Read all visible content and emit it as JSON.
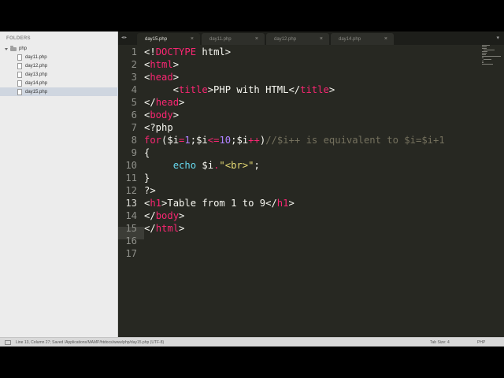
{
  "sidebar": {
    "header": "FOLDERS",
    "folder": "php",
    "files": [
      "day11.php",
      "day12.php",
      "day13.php",
      "day14.php",
      "day15.php"
    ],
    "active_file": "day15.php"
  },
  "tabs": [
    "day15.php",
    "day11.php",
    "day12.php",
    "day14.php"
  ],
  "active_tab": "day15.php",
  "editor": {
    "current_line": 13,
    "lines": [
      [
        [
          "<!",
          "t-txt"
        ],
        [
          "DOCTYPE",
          "t-tag"
        ],
        [
          " html>",
          "t-txt"
        ]
      ],
      [
        [
          "<",
          "t-txt"
        ],
        [
          "html",
          "t-tag"
        ],
        [
          ">",
          "t-txt"
        ]
      ],
      [
        [
          "<",
          "t-txt"
        ],
        [
          "head",
          "t-tag"
        ],
        [
          ">",
          "t-txt"
        ]
      ],
      [
        [
          "     <",
          "t-txt"
        ],
        [
          "title",
          "t-tag"
        ],
        [
          ">PHP with HTML</",
          "t-txt"
        ],
        [
          "title",
          "t-tag"
        ],
        [
          ">",
          "t-txt"
        ]
      ],
      [
        [
          "</",
          "t-txt"
        ],
        [
          "head",
          "t-tag"
        ],
        [
          ">",
          "t-txt"
        ]
      ],
      [
        [
          "<",
          "t-txt"
        ],
        [
          "body",
          "t-tag"
        ],
        [
          ">",
          "t-txt"
        ]
      ],
      [
        [
          "<?php",
          "t-txt"
        ]
      ],
      [
        [
          "for",
          "t-kw"
        ],
        [
          "(",
          "t-txt"
        ],
        [
          "$i",
          "t-txt"
        ],
        [
          "=",
          "t-op"
        ],
        [
          "1",
          "t-num"
        ],
        [
          ";",
          "t-txt"
        ],
        [
          "$i",
          "t-txt"
        ],
        [
          "<=",
          "t-op"
        ],
        [
          "10",
          "t-num"
        ],
        [
          ";",
          "t-txt"
        ],
        [
          "$i",
          "t-txt"
        ],
        [
          "++",
          "t-op"
        ],
        [
          ")",
          "t-txt"
        ],
        [
          "//$i++ is equivalent to $i=$i+1",
          "t-cm"
        ]
      ],
      [
        [
          "{",
          "t-txt"
        ]
      ],
      [
        [
          "     ",
          "t-txt"
        ],
        [
          "echo",
          "t-fn"
        ],
        [
          " $i",
          "t-txt"
        ],
        [
          ".",
          "t-op"
        ],
        [
          "\"<br>\"",
          "t-str"
        ],
        [
          ";",
          "t-txt"
        ]
      ],
      [
        [
          "}",
          "t-txt"
        ]
      ],
      [
        [
          "?>",
          "t-txt"
        ]
      ],
      [
        [
          "<",
          "t-txt"
        ],
        [
          "h1",
          "t-tag"
        ],
        [
          ">Table from 1 to 9</",
          "t-txt"
        ],
        [
          "h1",
          "t-tag"
        ],
        [
          ">",
          "t-txt"
        ]
      ],
      [
        [
          "</",
          "t-txt"
        ],
        [
          "body",
          "t-tag"
        ],
        [
          ">",
          "t-txt"
        ]
      ],
      [
        [
          "</",
          "t-txt"
        ],
        [
          "html",
          "t-tag"
        ],
        [
          ">",
          "t-txt"
        ]
      ],
      [
        [
          "",
          "t-txt"
        ]
      ],
      [
        [
          "",
          "t-txt"
        ]
      ]
    ]
  },
  "status": {
    "text": "Line 13, Column 27; Saved /Applications/MAMP/htdocs/www/php/day15.php (UTF-8)",
    "tab_size": "Tab Size: 4",
    "syntax": "PHP"
  }
}
